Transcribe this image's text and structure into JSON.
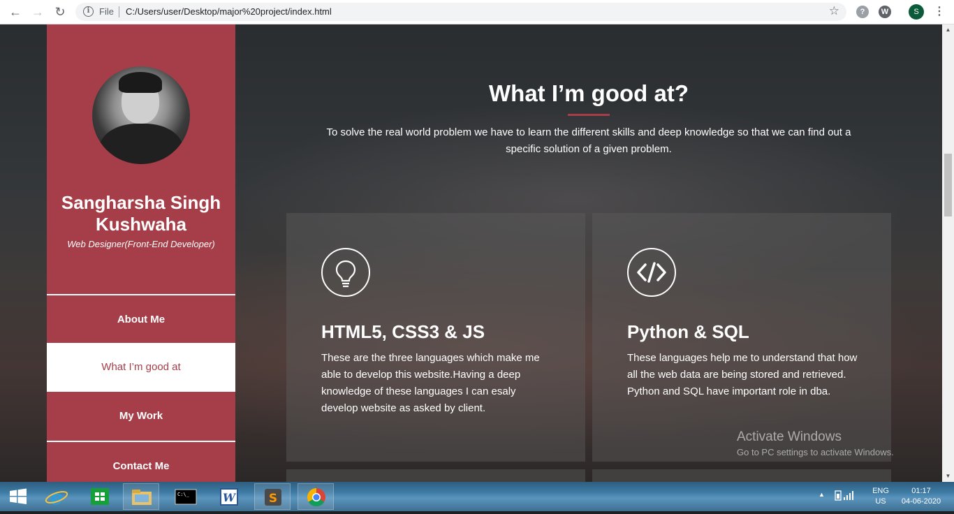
{
  "browser": {
    "back_glyph": "←",
    "forward_glyph": "→",
    "reload_glyph": "↻",
    "info_glyph": "i",
    "scheme_label": "File",
    "url": "C:/Users/user/Desktop/major%20project/index.html",
    "star_glyph": "☆",
    "ext1_glyph": "?",
    "ext2_glyph": "W",
    "profile_initial": "S",
    "menu_glyph": "⋮"
  },
  "scrollbar": {
    "up_glyph": "▲",
    "down_glyph": "▼"
  },
  "sidebar": {
    "name": "Sangharsha Singh Kushwaha",
    "role": "Web Designer(Front-End Developer)",
    "menu": [
      {
        "label": "About Me",
        "active": false
      },
      {
        "label": "What I’m good at",
        "active": true
      },
      {
        "label": "My Work",
        "active": false
      },
      {
        "label": "Contact Me",
        "active": false
      }
    ]
  },
  "skills": {
    "title": "What I’m good at?",
    "description": "To solve the real world problem we have to learn the different skills and deep knowledge so that we can find out a specific solution of a given problem.",
    "cards": [
      {
        "icon": "lightbulb-icon",
        "title": "HTML5, CSS3 & JS",
        "text": "These are the three languages which make me able to develop this website.Having a deep knowledge of these languages I can esaly develop website as asked by client."
      },
      {
        "icon": "code-icon",
        "title": "Python & SQL",
        "text": "These languages help me to understand that how all the web data are being stored and retrieved. Python and SQL have important role in dba."
      }
    ]
  },
  "watermark": {
    "title": "Activate Windows",
    "subtitle": "Go to PC settings to activate Windows."
  },
  "taskbar": {
    "cmd_label": "C:\\_",
    "word_letter": "W",
    "sublime_letter": "S",
    "lang_top": "ENG",
    "lang_bottom": "US",
    "time": "01:17",
    "date": "04-06-2020"
  },
  "colors": {
    "accent": "#a53e48",
    "card_bg": "rgba(95,95,95,0.42)"
  }
}
